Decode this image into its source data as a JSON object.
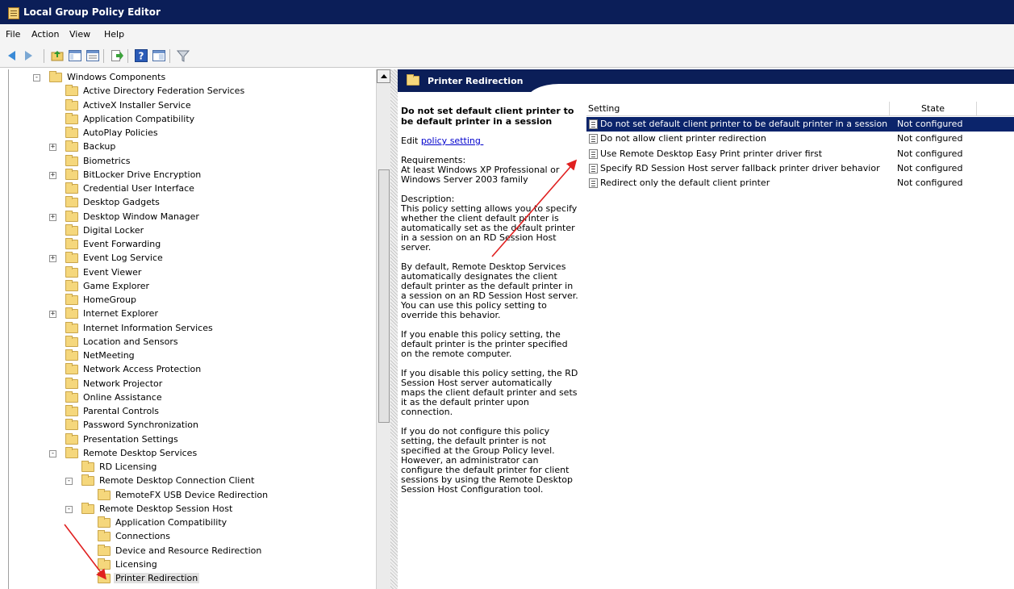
{
  "window": {
    "title": "Local Group Policy Editor"
  },
  "menu": [
    "File",
    "Action",
    "View",
    "Help"
  ],
  "toolbar": {
    "buttons": [
      "back-icon",
      "forward-icon",
      "up-folder-icon",
      "show-hide-tree-icon",
      "export-list-icon",
      "help-icon",
      "properties-icon",
      "filter-icon"
    ]
  },
  "tree": {
    "items": [
      {
        "label": "Windows Components",
        "indent": 0,
        "expander": "−"
      },
      {
        "label": "Active Directory Federation Services",
        "indent": 1,
        "expander": ""
      },
      {
        "label": "ActiveX Installer Service",
        "indent": 1,
        "expander": ""
      },
      {
        "label": "Application Compatibility",
        "indent": 1,
        "expander": ""
      },
      {
        "label": "AutoPlay Policies",
        "indent": 1,
        "expander": ""
      },
      {
        "label": "Backup",
        "indent": 1,
        "expander": "+"
      },
      {
        "label": "Biometrics",
        "indent": 1,
        "expander": ""
      },
      {
        "label": "BitLocker Drive Encryption",
        "indent": 1,
        "expander": "+"
      },
      {
        "label": "Credential User Interface",
        "indent": 1,
        "expander": ""
      },
      {
        "label": "Desktop Gadgets",
        "indent": 1,
        "expander": ""
      },
      {
        "label": "Desktop Window Manager",
        "indent": 1,
        "expander": "+"
      },
      {
        "label": "Digital Locker",
        "indent": 1,
        "expander": ""
      },
      {
        "label": "Event Forwarding",
        "indent": 1,
        "expander": ""
      },
      {
        "label": "Event Log Service",
        "indent": 1,
        "expander": "+"
      },
      {
        "label": "Event Viewer",
        "indent": 1,
        "expander": ""
      },
      {
        "label": "Game Explorer",
        "indent": 1,
        "expander": ""
      },
      {
        "label": "HomeGroup",
        "indent": 1,
        "expander": ""
      },
      {
        "label": "Internet Explorer",
        "indent": 1,
        "expander": "+"
      },
      {
        "label": "Internet Information Services",
        "indent": 1,
        "expander": ""
      },
      {
        "label": "Location and Sensors",
        "indent": 1,
        "expander": ""
      },
      {
        "label": "NetMeeting",
        "indent": 1,
        "expander": ""
      },
      {
        "label": "Network Access Protection",
        "indent": 1,
        "expander": ""
      },
      {
        "label": "Network Projector",
        "indent": 1,
        "expander": ""
      },
      {
        "label": "Online Assistance",
        "indent": 1,
        "expander": ""
      },
      {
        "label": "Parental Controls",
        "indent": 1,
        "expander": ""
      },
      {
        "label": "Password Synchronization",
        "indent": 1,
        "expander": ""
      },
      {
        "label": "Presentation Settings",
        "indent": 1,
        "expander": ""
      },
      {
        "label": "Remote Desktop Services",
        "indent": 1,
        "expander": "−"
      },
      {
        "label": "RD Licensing",
        "indent": 2,
        "expander": ""
      },
      {
        "label": "Remote Desktop Connection Client",
        "indent": 2,
        "expander": "−"
      },
      {
        "label": "RemoteFX USB Device Redirection",
        "indent": 3,
        "expander": ""
      },
      {
        "label": "Remote Desktop Session Host",
        "indent": 2,
        "expander": "−"
      },
      {
        "label": "Application Compatibility",
        "indent": 3,
        "expander": ""
      },
      {
        "label": "Connections",
        "indent": 3,
        "expander": ""
      },
      {
        "label": "Device and Resource Redirection",
        "indent": 3,
        "expander": ""
      },
      {
        "label": "Licensing",
        "indent": 3,
        "expander": ""
      },
      {
        "label": "Printer Redirection",
        "indent": 3,
        "expander": "",
        "selected": true
      }
    ]
  },
  "header": {
    "title": "Printer Redirection"
  },
  "description": {
    "title": "Do not set default client printer to be default printer in a session",
    "edit_prefix": "Edit ",
    "edit_link": "policy setting ",
    "requirements": "Requirements:\nAt least Windows XP Professional or Windows Server 2003 family",
    "paragraphs": [
      "Description:\nThis policy setting allows you to specify whether the client default printer is automatically set as the default printer in a session on an RD Session Host server.",
      "By default, Remote Desktop Services automatically designates the client default printer as the default printer in a session on an RD Session Host server. You can use this policy setting to override this behavior.",
      "If you enable this policy setting, the default printer is the printer specified on the remote computer.",
      "If you disable this policy setting, the RD Session Host server automatically maps the client default printer and sets it as the default printer upon connection.",
      "If you do not configure this policy setting, the default printer is not specified at the Group Policy level. However, an administrator can configure the default printer for client sessions by using the Remote Desktop Session Host Configuration tool."
    ]
  },
  "list": {
    "columns": {
      "setting": "Setting",
      "state": "State"
    },
    "rows": [
      {
        "name": "Do not set default client printer to be default printer in a session",
        "state": "Not configured",
        "selected": true
      },
      {
        "name": "Do not allow client printer redirection",
        "state": "Not configured"
      },
      {
        "name": "Use Remote Desktop Easy Print printer driver first",
        "state": "Not configured"
      },
      {
        "name": "Specify RD Session Host server fallback printer driver behavior",
        "state": "Not configured"
      },
      {
        "name": "Redirect only the default client printer",
        "state": "Not configured"
      }
    ]
  },
  "colors": {
    "titlebar": "#0b1e58",
    "selection": "#0b246b",
    "annotation_arrow": "#e02020",
    "folder": "#f5d77c"
  }
}
